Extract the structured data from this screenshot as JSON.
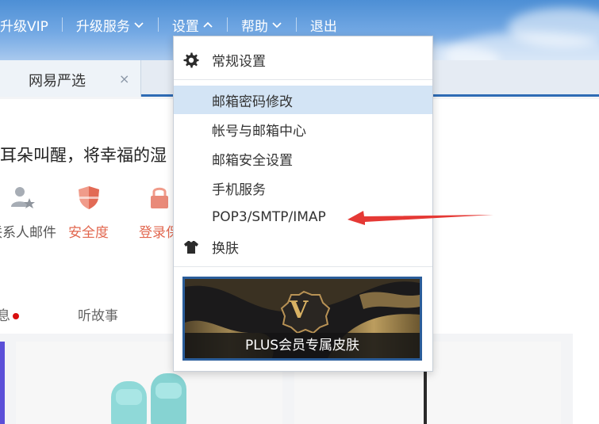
{
  "header": {
    "nav": [
      {
        "label": "升级VIP",
        "has_chevron": false
      },
      {
        "label": "升级服务",
        "has_chevron": true,
        "chevron": "chevron-down-icon"
      },
      {
        "label": "设置",
        "has_chevron": true,
        "chevron": "chevron-up-icon"
      },
      {
        "label": "帮助",
        "has_chevron": true,
        "chevron": "chevron-down-icon"
      },
      {
        "label": "退出",
        "has_chevron": false
      }
    ]
  },
  "tabs": [
    {
      "label": "网易严选",
      "close": "×"
    }
  ],
  "main": {
    "greeting": "耳朵叫醒，将幸福的湿",
    "quick_actions": [
      {
        "label": "联系人邮件",
        "icon": "contacts-star-icon"
      },
      {
        "label": "安全度",
        "icon": "shield-icon"
      },
      {
        "label": "登录保",
        "icon": "lock-icon"
      }
    ],
    "section_tabs": [
      {
        "label": "息",
        "has_dot": true
      },
      {
        "label": "听故事",
        "has_dot": false
      }
    ]
  },
  "settings_menu": {
    "items": [
      {
        "label": "常规设置",
        "icon": "gear-icon"
      },
      {
        "label": "邮箱密码修改",
        "highlighted": true
      },
      {
        "label": "帐号与邮箱中心"
      },
      {
        "label": "邮箱安全设置"
      },
      {
        "label": "手机服务"
      },
      {
        "label": "POP3/SMTP/IMAP"
      },
      {
        "label": "换肤",
        "icon": "tshirt-icon"
      }
    ],
    "banner": {
      "badge_letter": "V",
      "caption": "PLUS会员专属皮肤"
    }
  },
  "annotation": {
    "arrow_color": "#e53935",
    "points_to": "POP3/SMTP/IMAP"
  },
  "colors": {
    "header_blue": "#5a9ade",
    "accent_blue": "#2e6bb4",
    "menu_highlight": "#d3e4f5",
    "security_red": "#e2674f"
  }
}
